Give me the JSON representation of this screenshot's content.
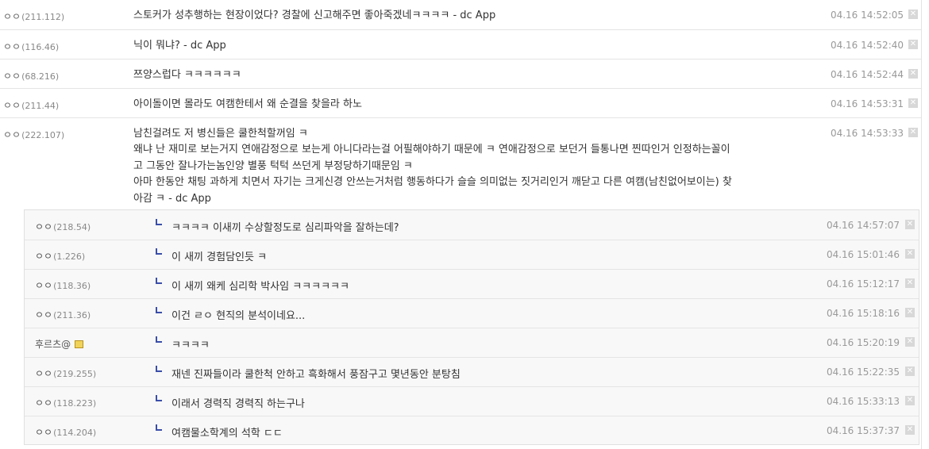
{
  "comments": [
    {
      "name": "ㅇㅇ",
      "ip": "(211.112)",
      "text": [
        "스토커가 성추행하는 현장이었다? 경찰에 신고해주면 좋아죽겠네ㅋㅋㅋㅋ - dc App"
      ],
      "date": "04.16 14:52:05"
    },
    {
      "name": "ㅇㅇ",
      "ip": "(116.46)",
      "text": [
        "닉이 뭐냐? - dc App"
      ],
      "date": "04.16 14:52:40"
    },
    {
      "name": "ㅇㅇ",
      "ip": "(68.216)",
      "text": [
        "쯔양스럽다 ㅋㅋㅋㅋㅋㅋ"
      ],
      "date": "04.16 14:52:44"
    },
    {
      "name": "ㅇㅇ",
      "ip": "(211.44)",
      "text": [
        "아이돌이면 몰라도 여캠한테서 왜 순결을 찾을라 하노"
      ],
      "date": "04.16 14:53:31"
    },
    {
      "name": "ㅇㅇ",
      "ip": "(222.107)",
      "text": [
        "남친걸려도 저 병신들은 쿨한척할꺼임 ㅋ",
        "왜냐 난 재미로 보는거지 연애감정으로 보는게 아니다라는걸 어필해야하기 때문에 ㅋ 연애감정으로 보던거 들통나면 찐따인거 인정하는꼴이",
        "고 그동안 잘나가는놈인양 별풍 턱턱 쓰던게 부정당하기때문임 ㅋ",
        "아마 한동안 채팅 과하게 치면서 자기는 크게신경 안쓰는거처럼 행동하다가 슬슬 의미없는 짓거리인거 깨닫고 다른 여캠(남친없어보이는) 찾",
        "아감 ㅋ - dc App"
      ],
      "date": "04.16 14:53:33"
    }
  ],
  "replies": [
    {
      "name": "ㅇㅇ",
      "ip": "(218.54)",
      "text": "ㅋㅋㅋㅋ 이새끼 수상할정도로 심리파악을 잘하는데?",
      "date": "04.16 14:57:07"
    },
    {
      "name": "ㅇㅇ",
      "ip": "(1.226)",
      "text": "이 새끼 경험담인듯 ㅋ",
      "date": "04.16 15:01:46"
    },
    {
      "name": "ㅇㅇ",
      "ip": "(118.36)",
      "text": "이 새끼 왜케 심리학 박사임 ㅋㅋㅋㅋㅋㅋ",
      "date": "04.16 15:12:17"
    },
    {
      "name": "ㅇㅇ",
      "ip": "(211.36)",
      "text": "이건 ㄹㅇ 현직의 분석이네요...",
      "date": "04.16 15:18:16"
    },
    {
      "name": "후르츠@",
      "ip": "",
      "badge": true,
      "text": "ㅋㅋㅋㅋ",
      "date": "04.16 15:20:19"
    },
    {
      "name": "ㅇㅇ",
      "ip": "(219.255)",
      "text": "재넨 진짜들이라 쿨한척 안하고 흑화해서 풍잠구고 몇년동안 분탕침",
      "date": "04.16 15:22:35"
    },
    {
      "name": "ㅇㅇ",
      "ip": "(118.223)",
      "text": "이래서 경력직 경력직 하는구나",
      "date": "04.16 15:33:13"
    },
    {
      "name": "ㅇㅇ",
      "ip": "(114.204)",
      "text": "여캠물소학계의 석학 ㄷㄷ",
      "date": "04.16 15:37:37"
    }
  ],
  "delete_icon_glyph": "✕"
}
